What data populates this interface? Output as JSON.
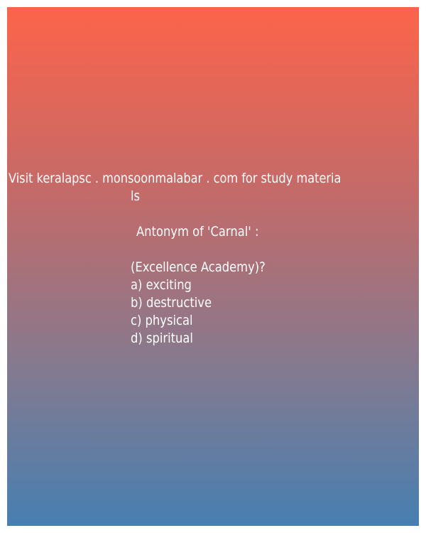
{
  "promo": {
    "line1": "Visit keralapsc . monsoonmalabar . com for study materia",
    "line2": "ls"
  },
  "question": {
    "title": "Antonym of 'Carnal' :",
    "source": "(Excellence Academy)?",
    "options": [
      "a) exciting",
      "b) destructive",
      "c) physical",
      "d) spiritual"
    ]
  },
  "colors": {
    "gradient_top": "#fc644a",
    "gradient_bottom": "#477fb1"
  }
}
